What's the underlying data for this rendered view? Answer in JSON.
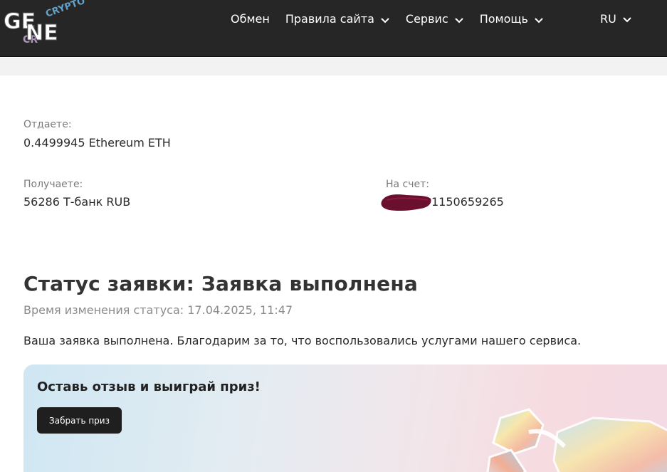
{
  "header": {
    "logo_text": "GENE",
    "logo_overlay_text": "CRYPTO",
    "nav": [
      {
        "label": "Обмен",
        "has_dropdown": false
      },
      {
        "label": "Правила сайта",
        "has_dropdown": true
      },
      {
        "label": "Сервис",
        "has_dropdown": true
      },
      {
        "label": "Помощь",
        "has_dropdown": true
      }
    ],
    "language": "RU",
    "colors": {
      "background": "#262626",
      "text": "#ffffff"
    }
  },
  "exchange": {
    "give_label": "Отдаете:",
    "give_value": "0.4499945 Ethereum ETH",
    "receive_label": "Получаете:",
    "receive_value": "56286 Т-банк RUB",
    "account_label": "На счет:",
    "account_value": "1150659265",
    "account_redaction_color": "#6b0f2e"
  },
  "status": {
    "title": "Статус заявки: Заявка выполнена",
    "changed_time": "Время изменения статуса: 17.04.2025, 11:47",
    "message": "Ваша заявка выполнена. Благодарим за то, что воспользовались услугами нашего сервиса."
  },
  "promo": {
    "title": "Оставь отзыв и выиграй приз!",
    "button_label": "Забрать приз"
  }
}
